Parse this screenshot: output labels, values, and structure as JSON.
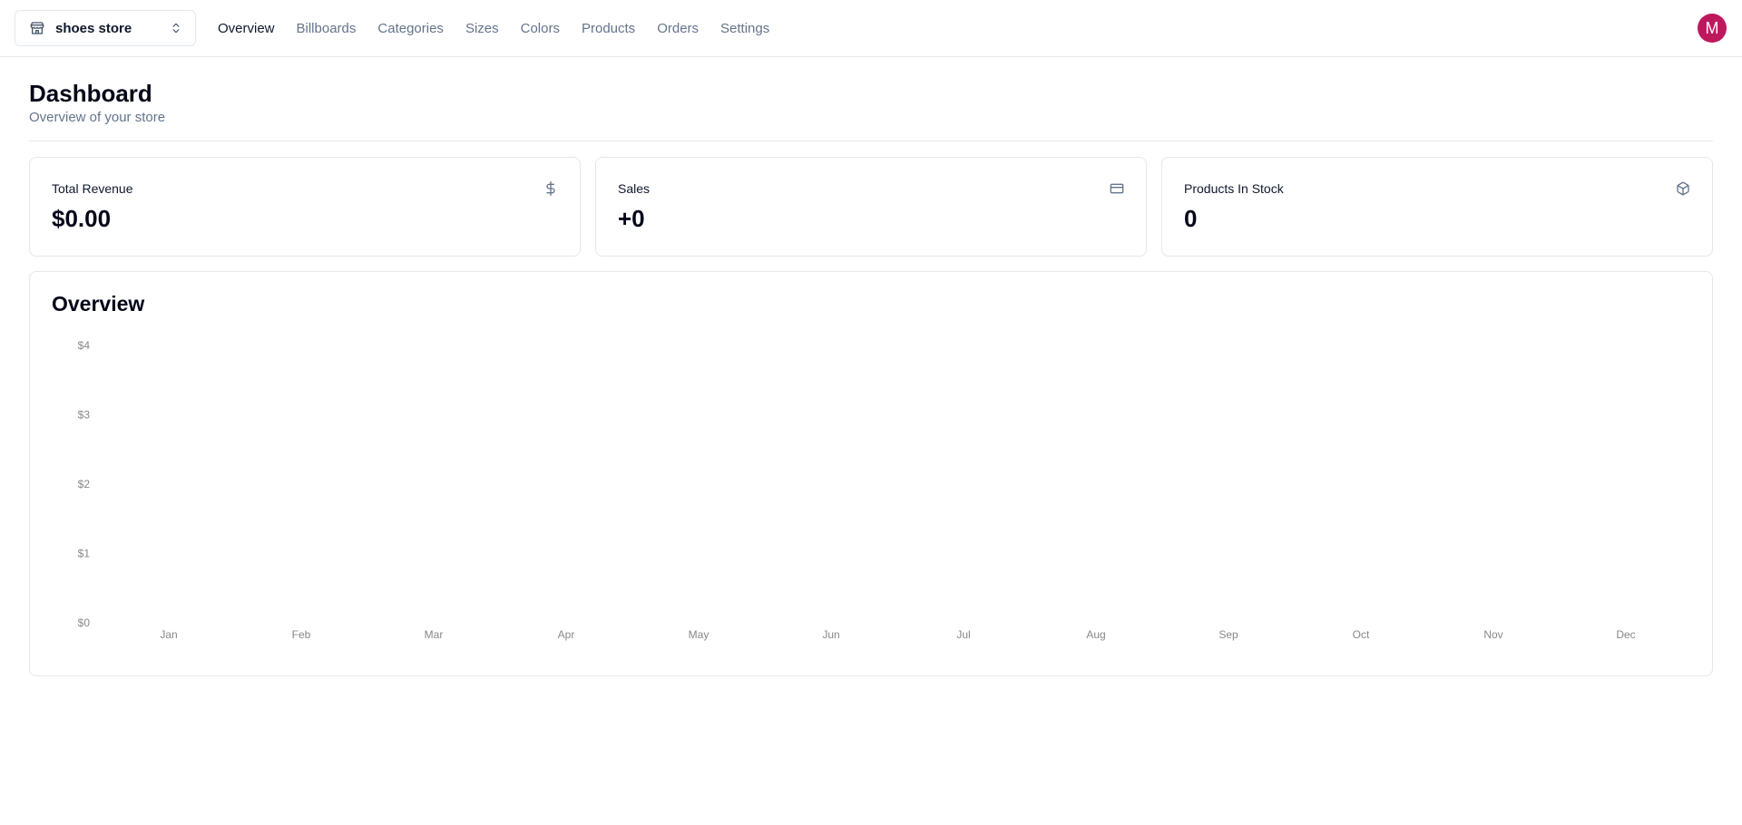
{
  "store_switcher": {
    "name": "shoes store"
  },
  "nav": {
    "items": [
      {
        "label": "Overview",
        "active": true
      },
      {
        "label": "Billboards",
        "active": false
      },
      {
        "label": "Categories",
        "active": false
      },
      {
        "label": "Sizes",
        "active": false
      },
      {
        "label": "Colors",
        "active": false
      },
      {
        "label": "Products",
        "active": false
      },
      {
        "label": "Orders",
        "active": false
      },
      {
        "label": "Settings",
        "active": false
      }
    ]
  },
  "user": {
    "avatar_initial": "M",
    "avatar_color": "#be185d"
  },
  "header": {
    "title": "Dashboard",
    "subtitle": "Overview of your store"
  },
  "stats": [
    {
      "label": "Total Revenue",
      "value": "$0.00",
      "icon": "dollar-sign-icon"
    },
    {
      "label": "Sales",
      "value": "+0",
      "icon": "credit-card-icon"
    },
    {
      "label": "Products In Stock",
      "value": "0",
      "icon": "package-icon"
    }
  ],
  "overview": {
    "title": "Overview"
  },
  "chart_data": {
    "type": "bar",
    "categories": [
      "Jan",
      "Feb",
      "Mar",
      "Apr",
      "May",
      "Jun",
      "Jul",
      "Aug",
      "Sep",
      "Oct",
      "Nov",
      "Dec"
    ],
    "values": [
      0,
      0,
      0,
      0,
      0,
      0,
      0,
      0,
      0,
      0,
      0,
      0
    ],
    "y_ticks": [
      "$0",
      "$1",
      "$2",
      "$3",
      "$4"
    ],
    "ylim": [
      0,
      4
    ],
    "grid": false,
    "title": "",
    "xlabel": "",
    "ylabel": ""
  }
}
